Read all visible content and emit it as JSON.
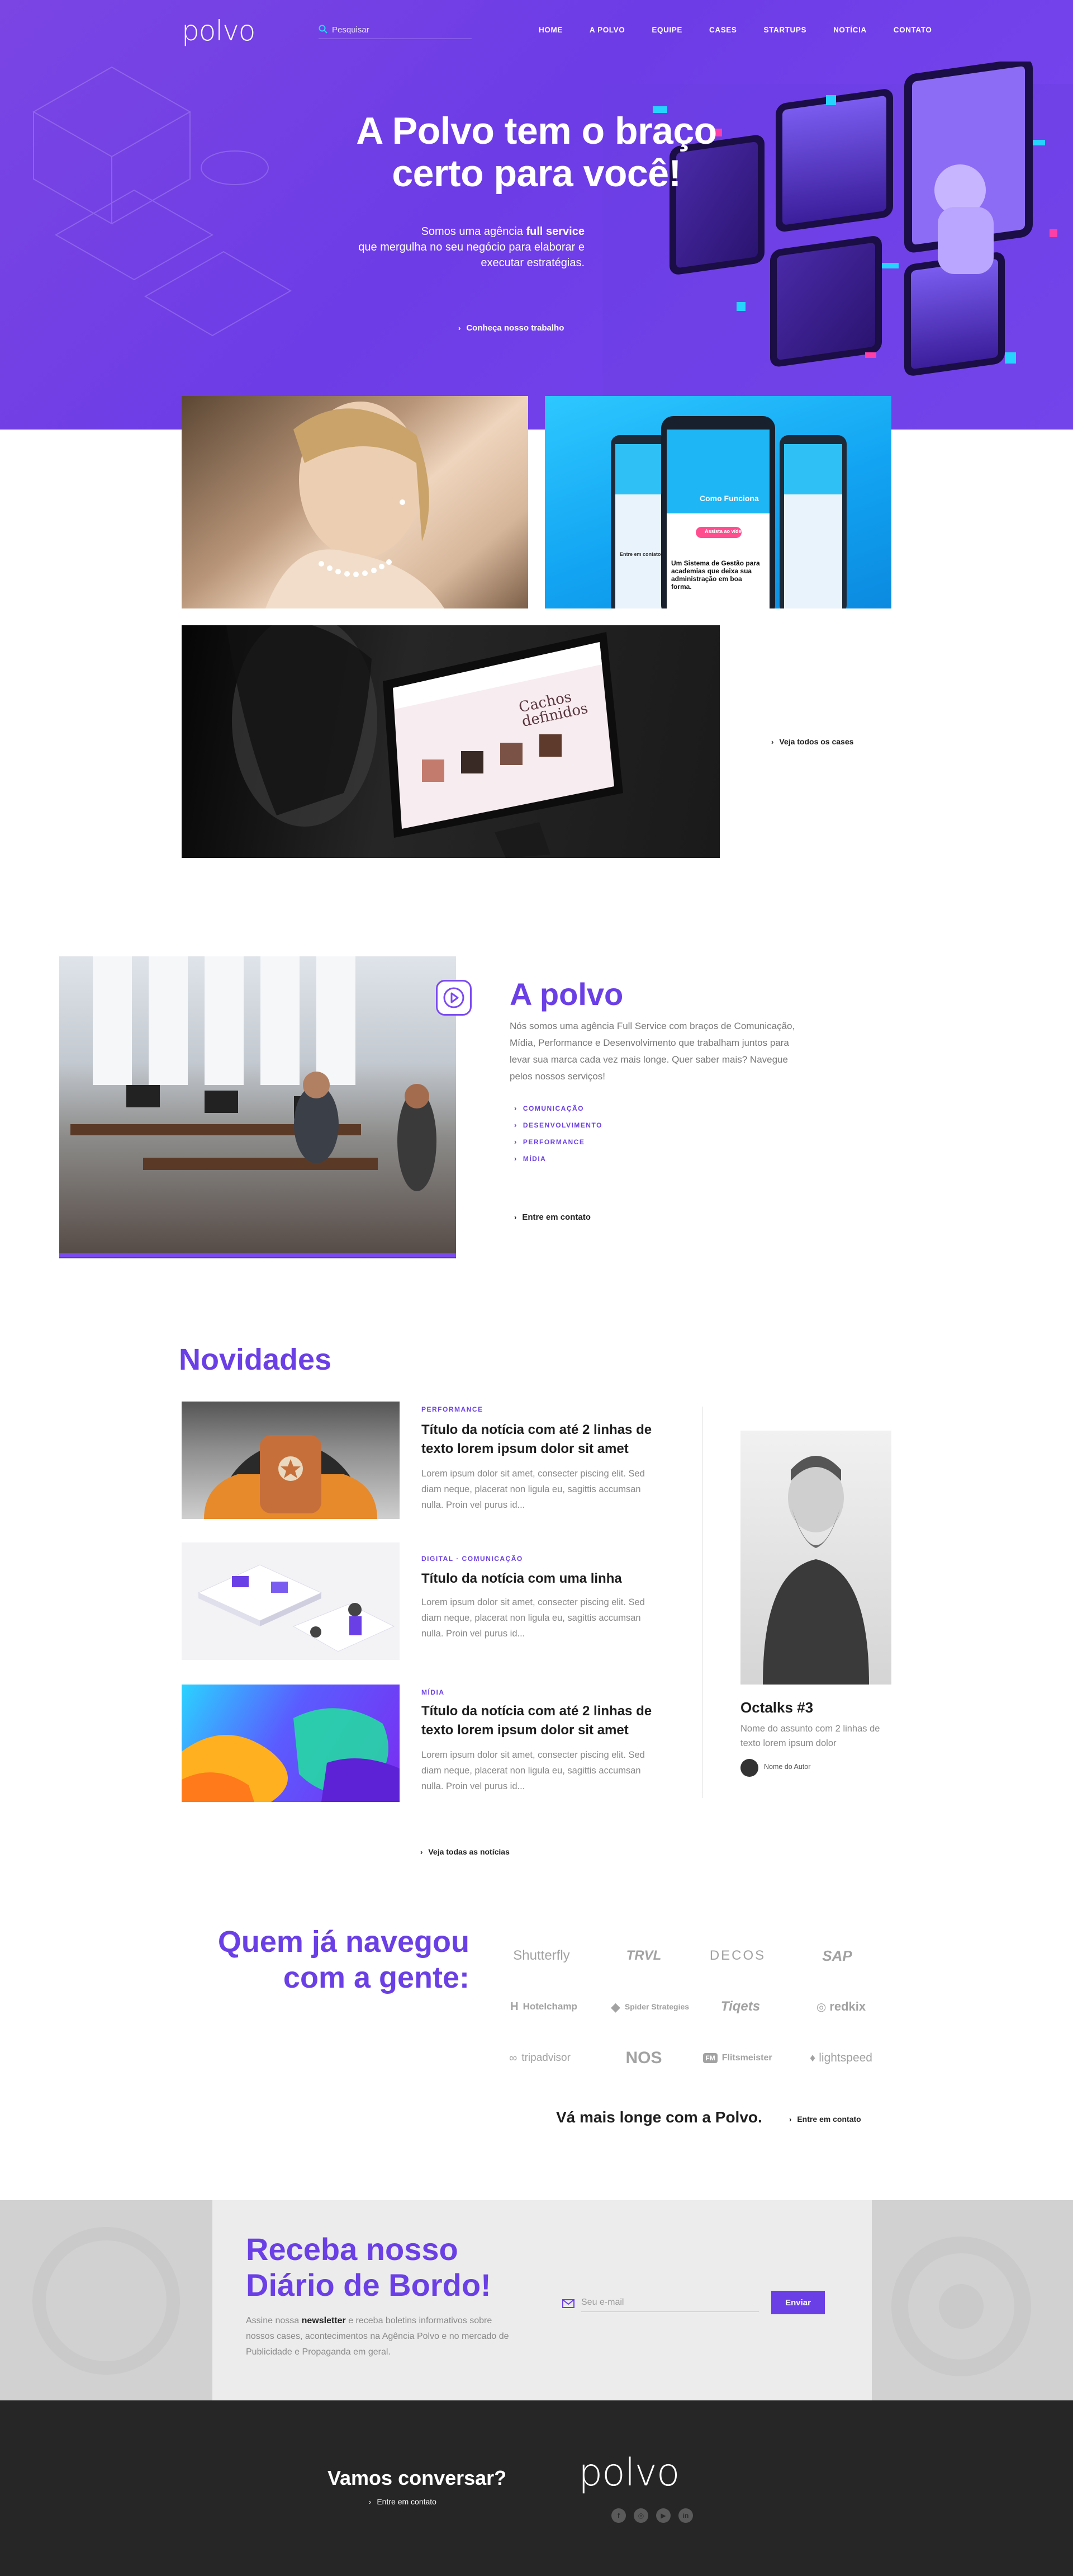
{
  "header": {
    "logo": "polvo",
    "search_placeholder": "Pesquisar",
    "nav": [
      "HOME",
      "A POLVO",
      "EQUIPE",
      "CASES",
      "STARTUPS",
      "NOTÍCIA",
      "CONTATO"
    ]
  },
  "hero": {
    "title_line1": "A Polvo tem o braço",
    "title_line2": "certo para você!",
    "sub_part1": "Somos uma agência ",
    "sub_bold": "full service",
    "sub_part2": "que mergulha no seu negócio para elaborar e executar estratégias.",
    "cta": "Conheça nosso trabalho"
  },
  "cases": {
    "mockup": {
      "title": "Como Funciona",
      "button": "Assista ao vídeo",
      "headline": "Um Sistema de Gestão para academias que deixa sua administração em boa forma.",
      "left_text": "Entre em contato"
    },
    "monitor_text": "Cachos definidos",
    "link": "Veja todos os cases"
  },
  "apolvo": {
    "title": "A polvo",
    "text": "Nós somos uma agência Full Service com braços de Comunicação, Mídia, Performance e Desenvolvimento que trabalham juntos para levar sua marca cada vez mais longe. Quer saber mais? Navegue pelos nossos serviços!",
    "services": [
      "COMUNICAÇÃO",
      "DESENVOLVIMENTO",
      "PERFORMANCE",
      "MÍDIA"
    ],
    "cta": "Entre em contato"
  },
  "novidades": {
    "title": "Novidades",
    "news": [
      {
        "category": "PERFORMANCE",
        "title": "Título da notícia com até 2 linhas de texto lorem ipsum dolor sit amet",
        "excerpt": "Lorem ipsum dolor sit amet, consecter piscing elit. Sed diam neque, placerat non ligula eu, sagittis accumsan nulla. Proin vel purus id..."
      },
      {
        "category": "DIGITAL · COMUNICAÇÃO",
        "title": "Título da notícia com uma linha",
        "excerpt": "Lorem ipsum dolor sit amet, consecter piscing elit. Sed diam neque, placerat non ligula eu, sagittis accumsan nulla. Proin vel purus id..."
      },
      {
        "category": "MÍDIA",
        "title": "Título da notícia com até 2 linhas de texto lorem ipsum dolor sit amet",
        "excerpt": "Lorem ipsum dolor sit amet, consecter piscing elit. Sed diam neque, placerat non ligula eu, sagittis accumsan nulla. Proin vel purus id..."
      }
    ],
    "octalks": {
      "title": "Octalks #3",
      "subtitle": "Nome do assunto com 2 linhas de texto lorem ipsum dolor",
      "author": "Nome do Autor"
    },
    "link": "Veja todas as notícias"
  },
  "clients": {
    "title_line1": "Quem já navegou",
    "title_line2": "com a gente:",
    "logos": [
      "Shutterfly",
      "TRVL",
      "DECOS",
      "SAP",
      "Hotelchamp",
      "Spider Strategies",
      "Tiqets",
      "redkix",
      "tripadvisor",
      "NOS",
      "Flitsmeister",
      "lightspeed"
    ],
    "tagline": "Vá mais longe com a Polvo.",
    "cta": "Entre em contato"
  },
  "newsletter": {
    "title_line1": "Receba nosso",
    "title_line2": "Diário de Bordo!",
    "text_part1": "Assine nossa ",
    "text_bold": "newsletter",
    "text_part2": " e receba boletins informativos sobre nossos cases, acontecimentos na Agência Polvo e no mercado de Publicidade e Propaganda em geral.",
    "placeholder": "Seu e-mail",
    "button": "Enviar"
  },
  "footer": {
    "title": "Vamos conversar?",
    "cta": "Entre em contato",
    "logo": "polvo",
    "social": [
      "facebook-icon",
      "instagram-icon",
      "youtube-icon",
      "linkedin-icon"
    ]
  },
  "colors": {
    "brand": "#6b3fe6",
    "hero": "#7444e6",
    "footer": "#262626"
  }
}
